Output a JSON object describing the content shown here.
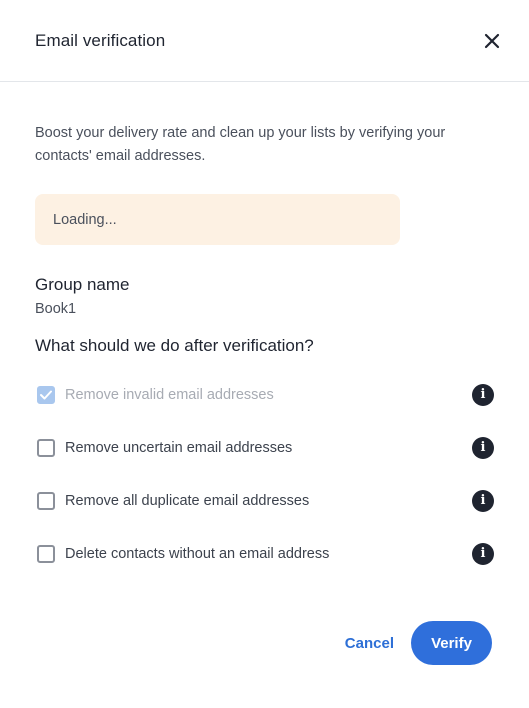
{
  "modal": {
    "title": "Email verification",
    "close_icon": "close-icon"
  },
  "description": "Boost your delivery rate and clean up your lists by verifying your contacts' email addresses.",
  "status": {
    "loading_text": "Loading..."
  },
  "group": {
    "label": "Group name",
    "value": "Book1"
  },
  "question": "What should we do after verification?",
  "options": [
    {
      "label": "Remove invalid email addresses",
      "checked": true,
      "disabled": true,
      "icon": "info-icon"
    },
    {
      "label": "Remove uncertain email addresses",
      "checked": false,
      "disabled": false,
      "icon": "info-icon"
    },
    {
      "label": "Remove all duplicate email addresses",
      "checked": false,
      "disabled": false,
      "icon": "info-icon"
    },
    {
      "label": "Delete contacts without an email address",
      "checked": false,
      "disabled": false,
      "icon": "info-icon"
    }
  ],
  "footer": {
    "cancel_label": "Cancel",
    "verify_label": "Verify"
  },
  "colors": {
    "primary": "#2f6fdb",
    "loading_bg": "#fdf1e3",
    "text_dark": "#1f2430",
    "disabled_check": "#a9c7ee"
  }
}
